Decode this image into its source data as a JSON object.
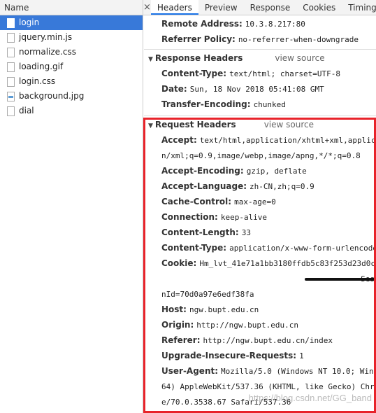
{
  "left_panel": {
    "header": "Name",
    "files": [
      {
        "name": "login",
        "icon": "document-icon",
        "selected": true
      },
      {
        "name": "jquery.min.js",
        "icon": "document-icon"
      },
      {
        "name": "normalize.css",
        "icon": "document-icon"
      },
      {
        "name": "loading.gif",
        "icon": "document-icon"
      },
      {
        "name": "login.css",
        "icon": "document-icon"
      },
      {
        "name": "background.jpg",
        "icon": "image-icon"
      },
      {
        "name": "dial",
        "icon": "document-icon"
      }
    ]
  },
  "tabs": {
    "close": "×",
    "items": [
      "Headers",
      "Preview",
      "Response",
      "Cookies",
      "Timing"
    ],
    "active": "Headers"
  },
  "general": {
    "remote_address": {
      "k": "Remote Address:",
      "v": "10.3.8.217:80"
    },
    "referrer_policy": {
      "k": "Referrer Policy:",
      "v": "no-referrer-when-downgrade"
    }
  },
  "response_headers": {
    "title": "Response Headers",
    "view_source": "view source",
    "rows": [
      {
        "k": "Content-Type:",
        "v": "text/html; charset=UTF-8"
      },
      {
        "k": "Date:",
        "v": "Sun, 18 Nov 2018 05:41:08 GMT"
      },
      {
        "k": "Transfer-Encoding:",
        "v": "chunked"
      }
    ]
  },
  "request_headers": {
    "title": "Request Headers",
    "view_source": "view source",
    "accept": {
      "k": "Accept:",
      "v": "text/html,application/xhtml+xml,applicat",
      "v2": "n/xml;q=0.9,image/webp,image/apng,*/*;q=0.8"
    },
    "accept_encoding": {
      "k": "Accept-Encoding:",
      "v": "gzip, deflate"
    },
    "accept_language": {
      "k": "Accept-Language:",
      "v": "zh-CN,zh;q=0.9"
    },
    "cache_control": {
      "k": "Cache-Control:",
      "v": "max-age=0"
    },
    "connection": {
      "k": "Connection:",
      "v": "keep-alive"
    },
    "content_length": {
      "k": "Content-Length:",
      "v": "33"
    },
    "content_type": {
      "k": "Content-Type:",
      "v": "application/x-www-form-urlencoded"
    },
    "cookie": {
      "k": "Cookie:",
      "v": "Hm_lvt_41e71a1bb3180ffdb5c83f253d23d0c",
      "v2_tail": "Ses",
      "v3": "nId=70d0a97e6edf38fa"
    },
    "host": {
      "k": "Host:",
      "v": "ngw.bupt.edu.cn"
    },
    "origin": {
      "k": "Origin:",
      "v": "http://ngw.bupt.edu.cn"
    },
    "referer": {
      "k": "Referer:",
      "v": "http://ngw.bupt.edu.cn/index"
    },
    "upgrade": {
      "k": "Upgrade-Insecure-Requests:",
      "v": "1"
    },
    "user_agent": {
      "k": "User-Agent:",
      "v": "Mozilla/5.0 (Windows NT 10.0; Win64",
      "v2": "64) AppleWebKit/537.36 (KHTML, like Gecko) Chr",
      "v3": "e/70.0.3538.67 Safari/537.36"
    }
  },
  "watermark": "https://blog.csdn.net/GG_band",
  "colors": {
    "selected": "#3879d9",
    "highlight_box": "#e8232a",
    "tab_underline": "#1a73e8"
  }
}
